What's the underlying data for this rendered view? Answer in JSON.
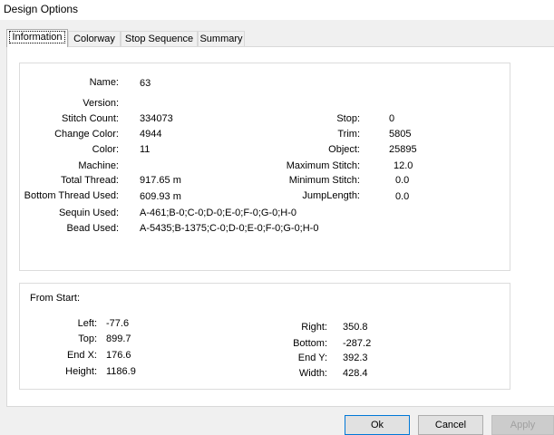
{
  "window": {
    "title": "Design Options"
  },
  "tabs": [
    "Information",
    "Colorway",
    "Stop Sequence",
    "Summary"
  ],
  "info": {
    "name_label": "Name:",
    "name_value": "63",
    "version_label": "Version:",
    "version_value": "",
    "stitch_count_label": "Stitch Count:",
    "stitch_count_value": "334073",
    "change_color_label": "Change Color:",
    "change_color_value": "4944",
    "color_label": "Color:",
    "color_value": "11",
    "machine_label": "Machine:",
    "machine_value": "",
    "total_thread_label": "Total Thread:",
    "total_thread_value": "917.65 m",
    "bottom_thread_label": "Bottom Thread Used:",
    "bottom_thread_value": "609.93 m",
    "sequin_label": "Sequin Used:",
    "sequin_value": "A-461;B-0;C-0;D-0;E-0;F-0;G-0;H-0",
    "bead_label": "Bead Used:",
    "bead_value": "A-5435;B-1375;C-0;D-0;E-0;F-0;G-0;H-0",
    "stop_label": "Stop:",
    "stop_value": "0",
    "trim_label": "Trim:",
    "trim_value": "5805",
    "object_label": "Object:",
    "object_value": "25895",
    "max_stitch_label": "Maximum Stitch:",
    "max_stitch_value": "12.0",
    "min_stitch_label": "Minimum Stitch:",
    "min_stitch_value": "0.0",
    "jump_length_label": "JumpLength:",
    "jump_length_value": "0.0"
  },
  "from_start": {
    "heading": "From Start:",
    "left_label": "Left:",
    "left_value": "-77.6",
    "top_label": "Top:",
    "top_value": "899.7",
    "endx_label": "End X:",
    "endx_value": "176.6",
    "height_label": "Height:",
    "height_value": "1186.9",
    "right_label": "Right:",
    "right_value": "350.8",
    "bottom_label": "Bottom:",
    "bottom_value": "-287.2",
    "endy_label": "End Y:",
    "endy_value": "392.3",
    "width_label": "Width:",
    "width_value": "428.4"
  },
  "buttons": {
    "ok": "Ok",
    "cancel": "Cancel",
    "apply": "Apply"
  }
}
